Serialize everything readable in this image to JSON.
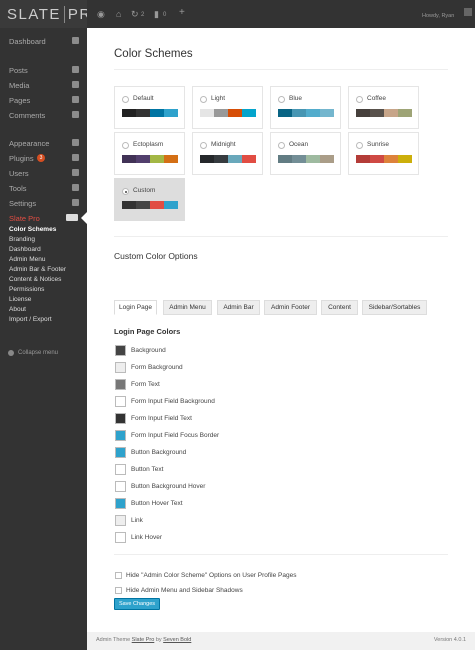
{
  "app": {
    "logo_main": "SLATE",
    "logo_sub": "PRO"
  },
  "topbar": {
    "comments_count": "2",
    "updates_count": "0",
    "greeting": "Howdy, Ryan"
  },
  "sidebar": {
    "items": [
      {
        "label": "Dashboard"
      },
      {
        "label": "Posts"
      },
      {
        "label": "Media"
      },
      {
        "label": "Pages"
      },
      {
        "label": "Comments"
      },
      {
        "label": "Appearance"
      },
      {
        "label": "Plugins",
        "badge": "3"
      },
      {
        "label": "Users"
      },
      {
        "label": "Tools"
      },
      {
        "label": "Settings"
      },
      {
        "label": "Slate Pro"
      }
    ],
    "submenu": [
      "Color Schemes",
      "Branding",
      "Dashboard",
      "Admin Menu",
      "Admin Bar & Footer",
      "Content & Notices",
      "Permissions",
      "License",
      "About",
      "Import / Export"
    ],
    "collapse_label": "Collapse menu"
  },
  "main": {
    "title": "Color Schemes",
    "schemes": [
      {
        "name": "Default",
        "colors": [
          "#222222",
          "#333333",
          "#0074a2",
          "#2ea2cc"
        ],
        "selected": false
      },
      {
        "name": "Light",
        "colors": [
          "#e5e5e5",
          "#999999",
          "#d64e07",
          "#04a4cc"
        ],
        "selected": false
      },
      {
        "name": "Blue",
        "colors": [
          "#096484",
          "#4796b3",
          "#52accc",
          "#74b6ce"
        ],
        "selected": false
      },
      {
        "name": "Coffee",
        "colors": [
          "#46403c",
          "#59524c",
          "#c7a589",
          "#9ea476"
        ],
        "selected": false
      },
      {
        "name": "Ectoplasm",
        "colors": [
          "#413256",
          "#523f6d",
          "#a3b745",
          "#d46f15"
        ],
        "selected": false
      },
      {
        "name": "Midnight",
        "colors": [
          "#25282b",
          "#363b3f",
          "#69a8bb",
          "#e14d43"
        ],
        "selected": false
      },
      {
        "name": "Ocean",
        "colors": [
          "#627c83",
          "#738e96",
          "#9ebaa0",
          "#aa9d88"
        ],
        "selected": false
      },
      {
        "name": "Sunrise",
        "colors": [
          "#b43c38",
          "#cf4944",
          "#dd823b",
          "#ccaf0b"
        ],
        "selected": false
      },
      {
        "name": "Custom",
        "colors": [
          "#333333",
          "#444444",
          "#e14d43",
          "#2ea2cc"
        ],
        "selected": true
      }
    ],
    "custom_options_title": "Custom Color Options",
    "tabs": [
      "Login Page",
      "Admin Menu",
      "Admin Bar",
      "Admin Footer",
      "Content",
      "Sidebar/Sortables"
    ],
    "active_tab": "Login Page",
    "section_title": "Login Page Colors",
    "color_fields": [
      {
        "label": "Background",
        "color": "#444444"
      },
      {
        "label": "Form Background",
        "color": "#eeeeee"
      },
      {
        "label": "Form Text",
        "color": "#777777"
      },
      {
        "label": "Form Input Field Background",
        "color": "#ffffff"
      },
      {
        "label": "Form Input Field Text",
        "color": "#333333"
      },
      {
        "label": "Form Input Field Focus Border",
        "color": "#2ea2cc"
      },
      {
        "label": "Button Background",
        "color": "#2ea2cc"
      },
      {
        "label": "Button Text",
        "color": "#ffffff"
      },
      {
        "label": "Button Background Hover",
        "color": "#ffffff"
      },
      {
        "label": "Button Hover Text",
        "color": "#2ea2cc"
      },
      {
        "label": "Link",
        "color": "#eeeeee"
      },
      {
        "label": "Link Hover",
        "color": "#ffffff"
      }
    ],
    "options": [
      "Hide \"Admin Color Scheme\" Options on User Profile Pages",
      "Hide Admin Menu and Sidebar Shadows"
    ],
    "save_label": "Save Changes"
  },
  "footer": {
    "credit_prefix": "Admin Theme ",
    "credit_link": "Slate Pro",
    "credit_by": " by ",
    "credit_author": "Seven Bold",
    "version": "Version 4.0.1"
  }
}
